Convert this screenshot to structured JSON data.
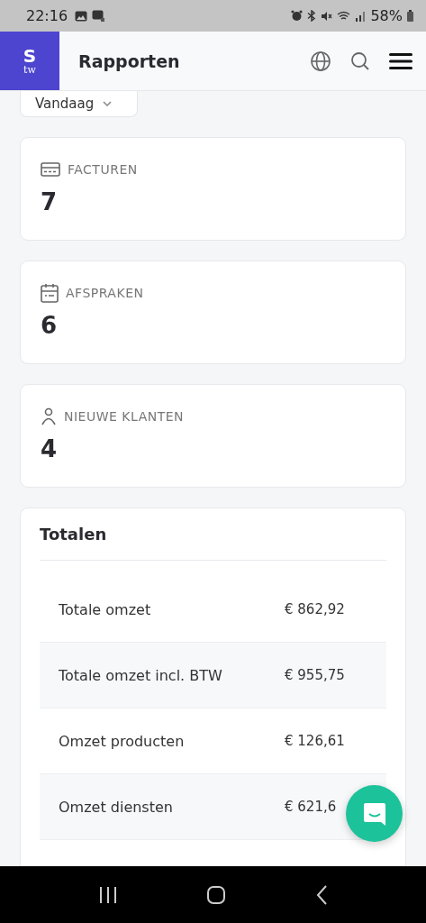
{
  "status_bar": {
    "time": "22:16",
    "battery": "58%"
  },
  "header": {
    "logo": "S",
    "logo_sub": "tw",
    "title": "Rapporten"
  },
  "period_dropdown": {
    "value": "Vandaag"
  },
  "stat_cards": [
    {
      "kind": "invoice",
      "label": "FACTUREN",
      "value": "7"
    },
    {
      "kind": "calendar",
      "label": "AFSPRAKEN",
      "value": "6"
    },
    {
      "kind": "person",
      "label": "NIEUWE KLANTEN",
      "value": "4"
    }
  ],
  "totals": {
    "title": "Totalen",
    "rows": [
      {
        "label": "Totale omzet",
        "value": "€ 862,92"
      },
      {
        "label": "Totale omzet incl. BTW",
        "value": "€ 955,75"
      },
      {
        "label": "Omzet producten",
        "value": "€ 126,61"
      },
      {
        "label": "Omzet diensten",
        "value": "€ 621,6"
      }
    ]
  }
}
